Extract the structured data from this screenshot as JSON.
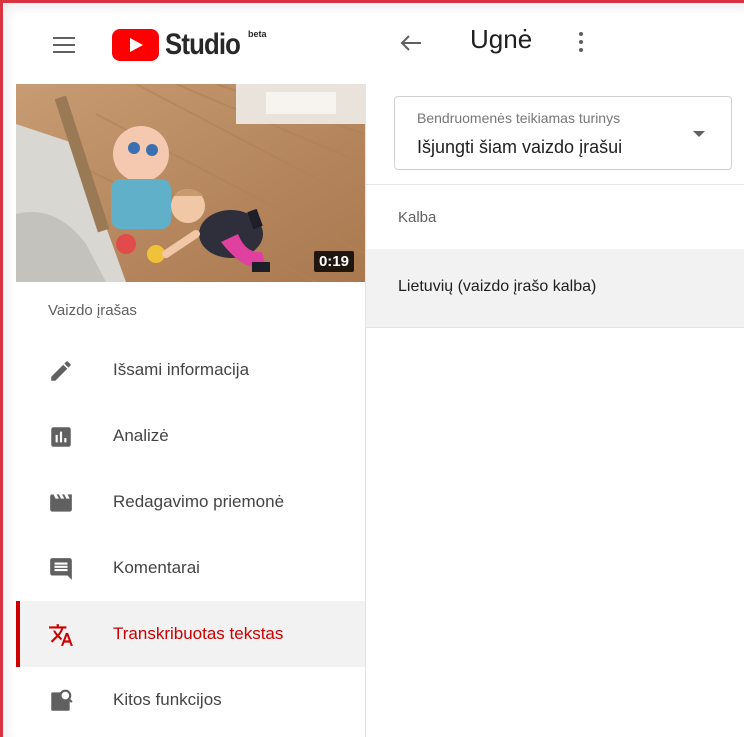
{
  "header": {
    "logo_text": "Studio",
    "logo_badge": "beta",
    "channel_title": "Ugnė",
    "icons": {
      "menu": "hamburger-icon",
      "back": "arrow-left-icon",
      "more": "kebab-menu-icon"
    }
  },
  "video": {
    "duration": "0:19"
  },
  "sidebar": {
    "section_label": "Vaizdo įrašas",
    "items": [
      {
        "label": "Išsami informacija",
        "icon": "pencil-icon",
        "active": false
      },
      {
        "label": "Analizė",
        "icon": "analytics-icon",
        "active": false
      },
      {
        "label": "Redagavimo priemonė",
        "icon": "clapperboard-icon",
        "active": false
      },
      {
        "label": "Komentarai",
        "icon": "comment-icon",
        "active": false
      },
      {
        "label": "Transkribuotas tekstas",
        "icon": "translate-icon",
        "active": true
      },
      {
        "label": "Kitos funkcijos",
        "icon": "features-search-icon",
        "active": false
      }
    ]
  },
  "main": {
    "community_select": {
      "label": "Bendruomenės teikiamas turinys",
      "value": "Išjungti šiam vaizdo įrašui"
    },
    "table": {
      "header": "Kalba",
      "rows": [
        "Lietuvių (vaizdo įrašo kalba)"
      ]
    }
  },
  "colors": {
    "accent": "#cc0000",
    "frame": "#d9333f",
    "active_bg": "#f2f2f2"
  }
}
